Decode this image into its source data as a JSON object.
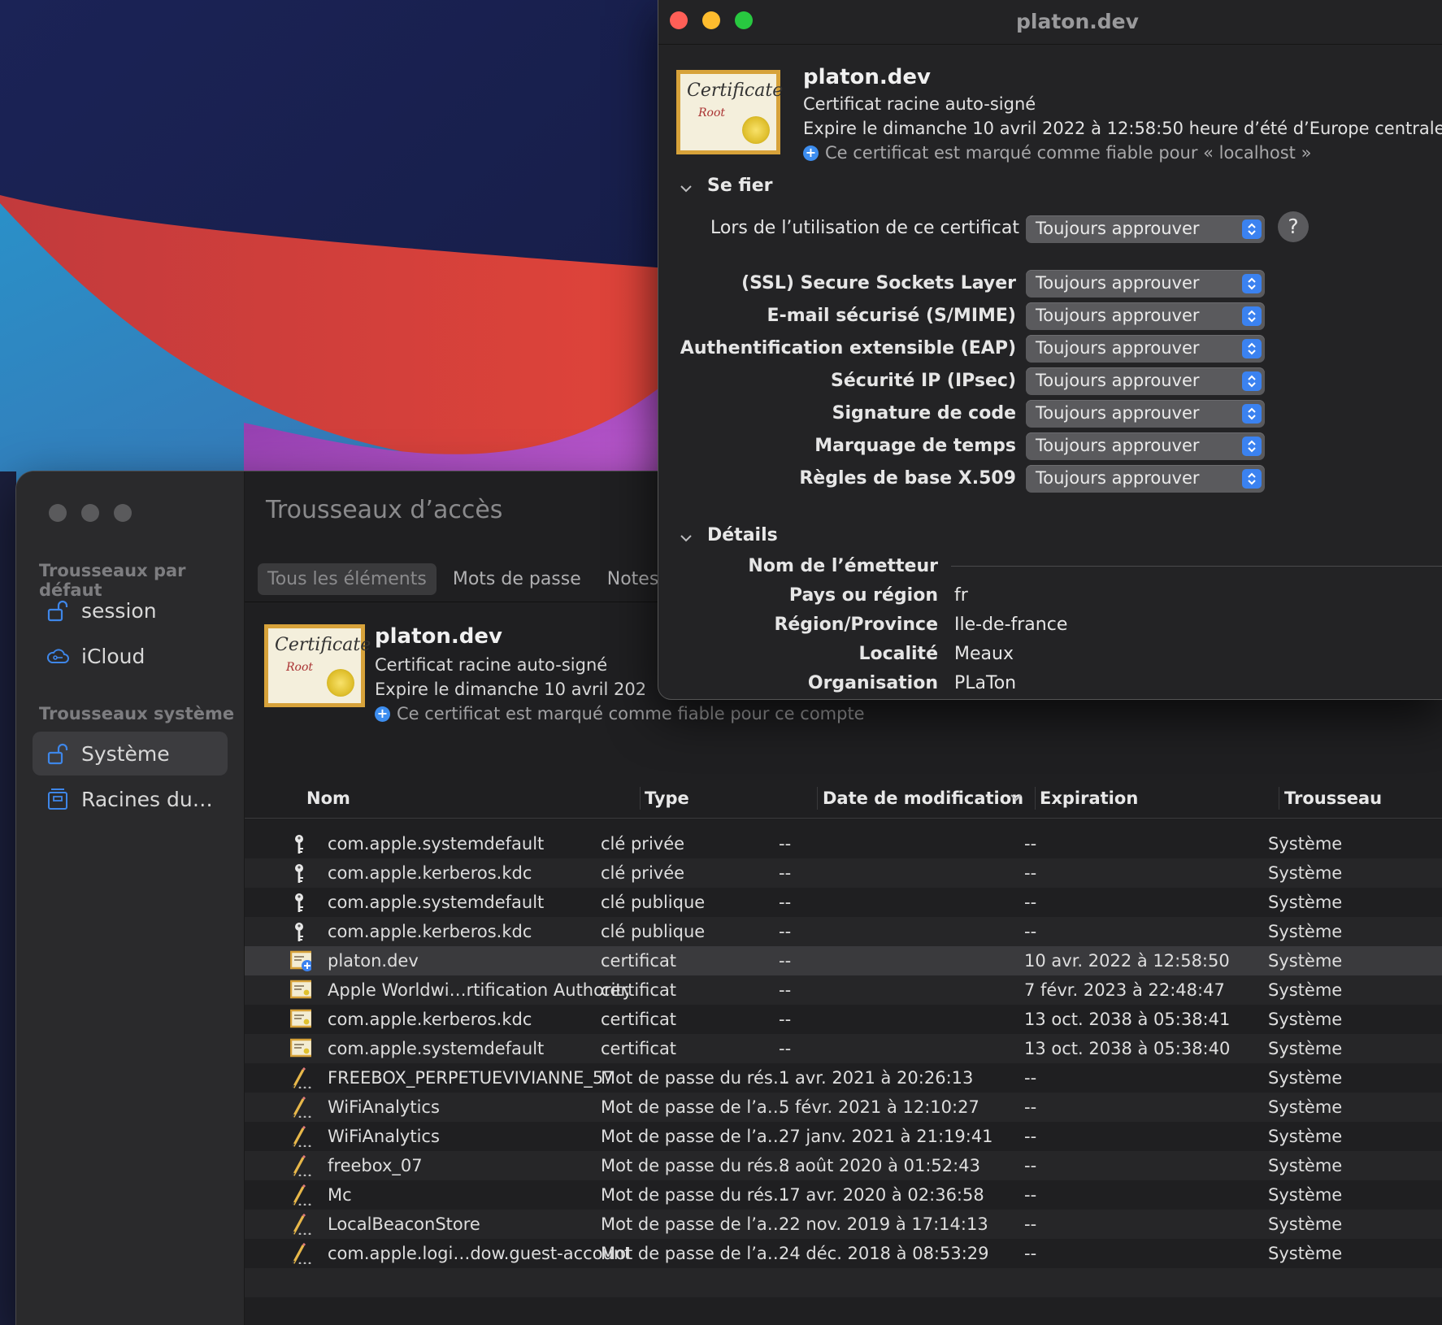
{
  "colors": {
    "traffic_close": "#ff5f57",
    "traffic_min": "#febc2e",
    "traffic_max": "#28c840",
    "accent": "#3b82f0"
  },
  "keychain": {
    "title": "Trousseaux d’accès",
    "sidebar": {
      "section_default": "Trousseaux par défaut",
      "section_system": "Trousseaux système",
      "items": [
        {
          "label": "session",
          "icon": "unlock-icon"
        },
        {
          "label": "iCloud",
          "icon": "icloud-icon"
        },
        {
          "label": "Système",
          "icon": "unlock-icon",
          "selected": true
        },
        {
          "label": "Racines du…",
          "icon": "cabinet-icon"
        }
      ]
    },
    "tabs": [
      {
        "label": "Tous les éléments",
        "selected": true
      },
      {
        "label": "Mots de passe"
      },
      {
        "label": "Notes s"
      }
    ],
    "cert": {
      "name": "platon.dev",
      "kind": "Certificat racine auto-signé",
      "expires": "Expire le dimanche 10 avril 202",
      "trust": "Ce certificat est marqué comme fiable pour ce compte"
    },
    "columns": {
      "name": "Nom",
      "type": "Type",
      "modified": "Date de modification",
      "expiration": "Expiration",
      "keychain": "Trousseau"
    },
    "rows": [
      {
        "icon": "key-icon",
        "name": "com.apple.systemdefault",
        "type": "clé privée",
        "modified": "--",
        "expiration": "--",
        "keychain": "Système"
      },
      {
        "icon": "key-icon",
        "name": "com.apple.kerberos.kdc",
        "type": "clé privée",
        "modified": "--",
        "expiration": "--",
        "keychain": "Système"
      },
      {
        "icon": "key-icon",
        "name": "com.apple.systemdefault",
        "type": "clé publique",
        "modified": "--",
        "expiration": "--",
        "keychain": "Système"
      },
      {
        "icon": "key-icon",
        "name": "com.apple.kerberos.kdc",
        "type": "clé publique",
        "modified": "--",
        "expiration": "--",
        "keychain": "Système"
      },
      {
        "icon": "trusted-certificate-icon",
        "name": "platon.dev",
        "type": "certificat",
        "modified": "--",
        "expiration": "10 avr. 2022 à 12:58:50",
        "keychain": "Système",
        "selected": true
      },
      {
        "icon": "certificate-icon",
        "name": "Apple Worldwi…rtification Authority",
        "type": "certificat",
        "modified": "--",
        "expiration": "7 févr. 2023 à 22:48:47",
        "keychain": "Système"
      },
      {
        "icon": "certificate-icon",
        "name": "com.apple.kerberos.kdc",
        "type": "certificat",
        "modified": "--",
        "expiration": "13 oct. 2038 à 05:38:41",
        "keychain": "Système"
      },
      {
        "icon": "certificate-icon",
        "name": "com.apple.systemdefault",
        "type": "certificat",
        "modified": "--",
        "expiration": "13 oct. 2038 à 05:38:40",
        "keychain": "Système"
      },
      {
        "icon": "password-icon",
        "name": "FREEBOX_PERPETUEVIVIANNE_57",
        "type": "Mot de passe du rés…",
        "modified": "1 avr. 2021 à 20:26:13",
        "expiration": "--",
        "keychain": "Système"
      },
      {
        "icon": "password-icon",
        "name": "WiFiAnalytics",
        "type": "Mot de passe de l’a…",
        "modified": "5 févr. 2021 à 12:10:27",
        "expiration": "--",
        "keychain": "Système"
      },
      {
        "icon": "password-icon",
        "name": "WiFiAnalytics",
        "type": "Mot de passe de l’a…",
        "modified": "27 janv. 2021 à 21:19:41",
        "expiration": "--",
        "keychain": "Système"
      },
      {
        "icon": "password-icon",
        "name": "freebox_07",
        "type": "Mot de passe du rés…",
        "modified": "8 août 2020 à 01:52:43",
        "expiration": "--",
        "keychain": "Système"
      },
      {
        "icon": "password-icon",
        "name": "Mc",
        "type": "Mot de passe du rés…",
        "modified": "17 avr. 2020 à 02:36:58",
        "expiration": "--",
        "keychain": "Système"
      },
      {
        "icon": "password-icon",
        "name": "LocalBeaconStore",
        "type": "Mot de passe de l’a…",
        "modified": "22 nov. 2019 à 17:14:13",
        "expiration": "--",
        "keychain": "Système"
      },
      {
        "icon": "password-icon",
        "name": "com.apple.logi…dow.guest-account",
        "type": "Mot de passe de l’a…",
        "modified": "24 déc. 2018 à 08:53:29",
        "expiration": "--",
        "keychain": "Système"
      }
    ]
  },
  "cert_window": {
    "title": "platon.dev",
    "thumb_text": "Certificate",
    "thumb_sub": "Root",
    "name": "platon.dev",
    "kind": "Certificat racine auto-signé",
    "expires": "Expire le dimanche 10 avril 2022 à 12:58:50 heure d’été d’Europe centrale",
    "trust": "Ce certificat est marqué comme fiable pour « localhost »",
    "trust_section": {
      "title": "Se fier",
      "when_using_label": "Lors de l’utilisation de ce certificat :",
      "when_using_value": "Toujours approuver",
      "help": "?",
      "policies": [
        {
          "label": "(SSL) Secure Sockets Layer",
          "value": "Toujours approuver"
        },
        {
          "label": "E-mail sécurisé (S/MIME)",
          "value": "Toujours approuver"
        },
        {
          "label": "Authentification extensible (EAP)",
          "value": "Toujours approuver"
        },
        {
          "label": "Sécurité IP (IPsec)",
          "value": "Toujours approuver"
        },
        {
          "label": "Signature de code",
          "value": "Toujours approuver"
        },
        {
          "label": "Marquage de temps",
          "value": "Toujours approuver"
        },
        {
          "label": "Règles de base X.509",
          "value": "Toujours approuver"
        }
      ]
    },
    "details_section": {
      "title": "Détails",
      "issuer_heading": "Nom de l’émetteur",
      "fields": [
        {
          "label": "Pays ou région",
          "value": "fr"
        },
        {
          "label": "Région/Province",
          "value": "Ile-de-france"
        },
        {
          "label": "Localité",
          "value": "Meaux"
        },
        {
          "label": "Organisation",
          "value": "PLaTon"
        }
      ]
    }
  }
}
